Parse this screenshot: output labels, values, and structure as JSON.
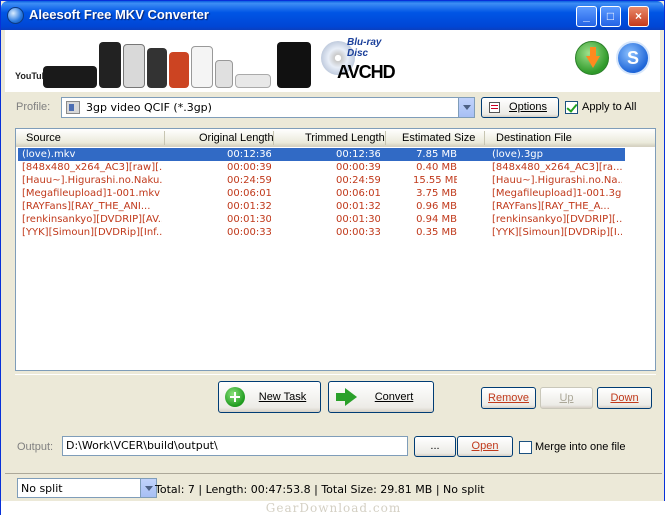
{
  "window": {
    "title": "Aleesoft Free MKV Converter",
    "controls": {
      "minimize": "_",
      "maximize": "□",
      "close": "×"
    }
  },
  "banner": {
    "youtube": "YouTube",
    "bluray": "Blu-ray Disc",
    "avchd": "AVCHD",
    "download_icon": "download-arrow-icon",
    "s_button": "S"
  },
  "profile": {
    "label": "Profile:",
    "value": "3gp video QCIF (*.3gp)",
    "options_label": "Options",
    "apply_to_all_label": "Apply to All",
    "apply_to_all_checked": true
  },
  "list": {
    "columns": [
      "Source",
      "Original Length",
      "Trimmed Length",
      "Estimated Size",
      "Destination File"
    ],
    "rows": [
      [
        "(love).mkv",
        "00:12:36",
        "00:12:36",
        "7.85 MB",
        "(love).3gp"
      ],
      [
        "[848x480_x264_AC3][raw][...",
        "00:00:39",
        "00:00:39",
        "0.40 MB",
        "[848x480_x264_AC3][ra..."
      ],
      [
        "[Hauu~].Higurashi.no.Naku...",
        "00:24:59",
        "00:24:59",
        "15.55 MB",
        "[Hauu~].Higurashi.no.Na..."
      ],
      [
        "[Megafileupload]1-001.mkv",
        "00:06:01",
        "00:06:01",
        "3.75 MB",
        "[Megafileupload]1-001.3gp"
      ],
      [
        "[RAYFans][RAY_THE_ANI...",
        "00:01:32",
        "00:01:32",
        "0.96 MB",
        "[RAYFans][RAY_THE_A..."
      ],
      [
        "[renkinsankyo][DVDRIP][AV...",
        "00:01:30",
        "00:01:30",
        "0.94 MB",
        "[renkinsankyo][DVDRIP][..."
      ],
      [
        "[YYK][Simoun][DVDRip][Inf...",
        "00:00:33",
        "00:00:33",
        "0.35 MB",
        "[YYK][Simoun][DVDRip][I..."
      ]
    ],
    "selected_index": 0
  },
  "actions": {
    "new_task": "New Task",
    "convert": "Convert",
    "remove": "Remove",
    "up": "Up",
    "down": "Down"
  },
  "output": {
    "label": "Output:",
    "path": "D:\\Work\\VCER\\build\\output\\",
    "browse": "...",
    "open": "Open",
    "merge_label": "Merge into one file",
    "merge_checked": false
  },
  "status": {
    "split_value": "No split",
    "summary": "Total: 7 | Length: 00:47:53.8 | Total Size: 29.81 MB | No split"
  },
  "watermark": "GearDownload.com",
  "colors": {
    "accent_red": "#c0391b",
    "selection": "#316ac5",
    "title_blue": "#0055e5"
  }
}
